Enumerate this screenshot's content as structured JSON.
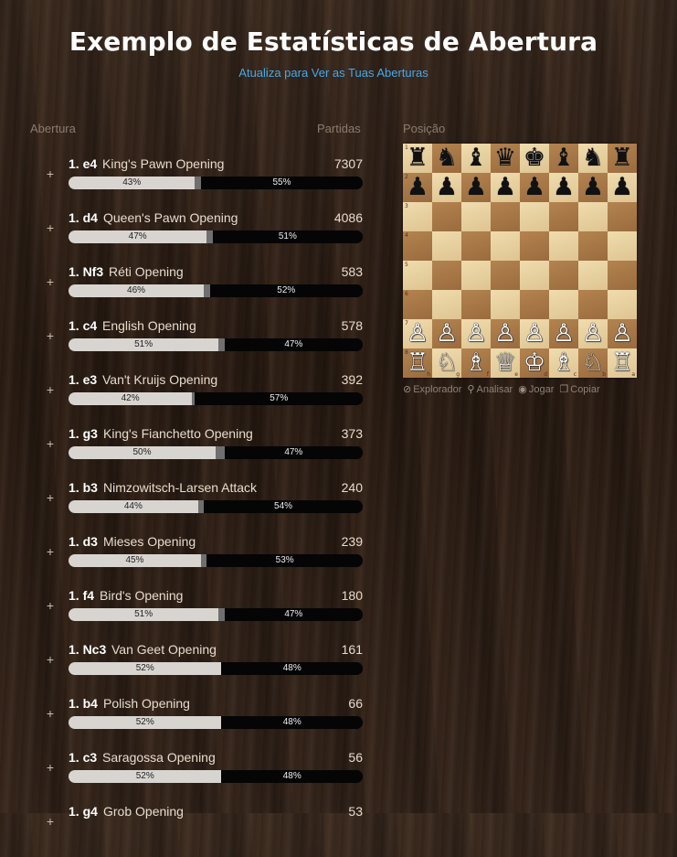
{
  "header": {
    "title": "Exemplo de Estatísticas de Abertura",
    "subtitle": "Atualiza para Ver as Tuas Aberturas"
  },
  "columns": {
    "opening": "Abertura",
    "games": "Partidas",
    "position": "Posição"
  },
  "openings": [
    {
      "move": "1. e4",
      "name": "King's Pawn Opening",
      "games": "7307",
      "white": 43,
      "white_label": "43%",
      "black": 55,
      "black_label": "55%"
    },
    {
      "move": "1. d4",
      "name": "Queen's Pawn Opening",
      "games": "4086",
      "white": 47,
      "white_label": "47%",
      "black": 51,
      "black_label": "51%"
    },
    {
      "move": "1. Nf3",
      "name": "Réti Opening",
      "games": "583",
      "white": 46,
      "white_label": "46%",
      "black": 52,
      "black_label": "52%"
    },
    {
      "move": "1. c4",
      "name": "English Opening",
      "games": "578",
      "white": 51,
      "white_label": "51%",
      "black": 47,
      "black_label": "47%"
    },
    {
      "move": "1. e3",
      "name": "Van't Kruijs Opening",
      "games": "392",
      "white": 42,
      "white_label": "42%",
      "black": 57,
      "black_label": "57%"
    },
    {
      "move": "1. g3",
      "name": "King's Fianchetto Opening",
      "games": "373",
      "white": 50,
      "white_label": "50%",
      "black": 47,
      "black_label": "47%"
    },
    {
      "move": "1. b3",
      "name": "Nimzowitsch-Larsen Attack",
      "games": "240",
      "white": 44,
      "white_label": "44%",
      "black": 54,
      "black_label": "54%"
    },
    {
      "move": "1. d3",
      "name": "Mieses Opening",
      "games": "239",
      "white": 45,
      "white_label": "45%",
      "black": 53,
      "black_label": "53%"
    },
    {
      "move": "1. f4",
      "name": "Bird's Opening",
      "games": "180",
      "white": 51,
      "white_label": "51%",
      "black": 47,
      "black_label": "47%"
    },
    {
      "move": "1. Nc3",
      "name": "Van Geet Opening",
      "games": "161",
      "white": 52,
      "white_label": "52%",
      "black": 48,
      "black_label": "48%"
    },
    {
      "move": "1. b4",
      "name": "Polish Opening",
      "games": "66",
      "white": 52,
      "white_label": "52%",
      "black": 48,
      "black_label": "48%"
    },
    {
      "move": "1. c3",
      "name": "Saragossa Opening",
      "games": "56",
      "white": 52,
      "white_label": "52%",
      "black": 48,
      "black_label": "48%"
    },
    {
      "move": "1. g4",
      "name": "Grob Opening",
      "games": "53",
      "white": 0,
      "white_label": "",
      "black": 0,
      "black_label": ""
    }
  ],
  "expand_symbol": "+",
  "board": {
    "ranks": [
      "r n b q k b n r",
      "p p p p p p p p",
      ". . . . . . . .",
      ". . . . . . . .",
      ". . . . . . . .",
      ". . . . . . . .",
      "P P P P P P P P",
      "R N B Q K B N R"
    ],
    "rank_labels": [
      "1",
      "2",
      "3",
      "4",
      "5",
      "6",
      "7",
      "8"
    ],
    "file_labels": [
      "h",
      "g",
      "f",
      "e",
      "d",
      "c",
      "b",
      "a"
    ],
    "orientation": "black-at-bottom"
  },
  "actions": [
    {
      "icon": "explorer-icon",
      "glyph": "⊘",
      "label": "Explorador"
    },
    {
      "icon": "analyze-icon",
      "glyph": "⚲",
      "label": "Analisar"
    },
    {
      "icon": "play-icon",
      "glyph": "◉",
      "label": "Jogar"
    },
    {
      "icon": "copy-icon",
      "glyph": "❐",
      "label": "Copiar"
    }
  ]
}
